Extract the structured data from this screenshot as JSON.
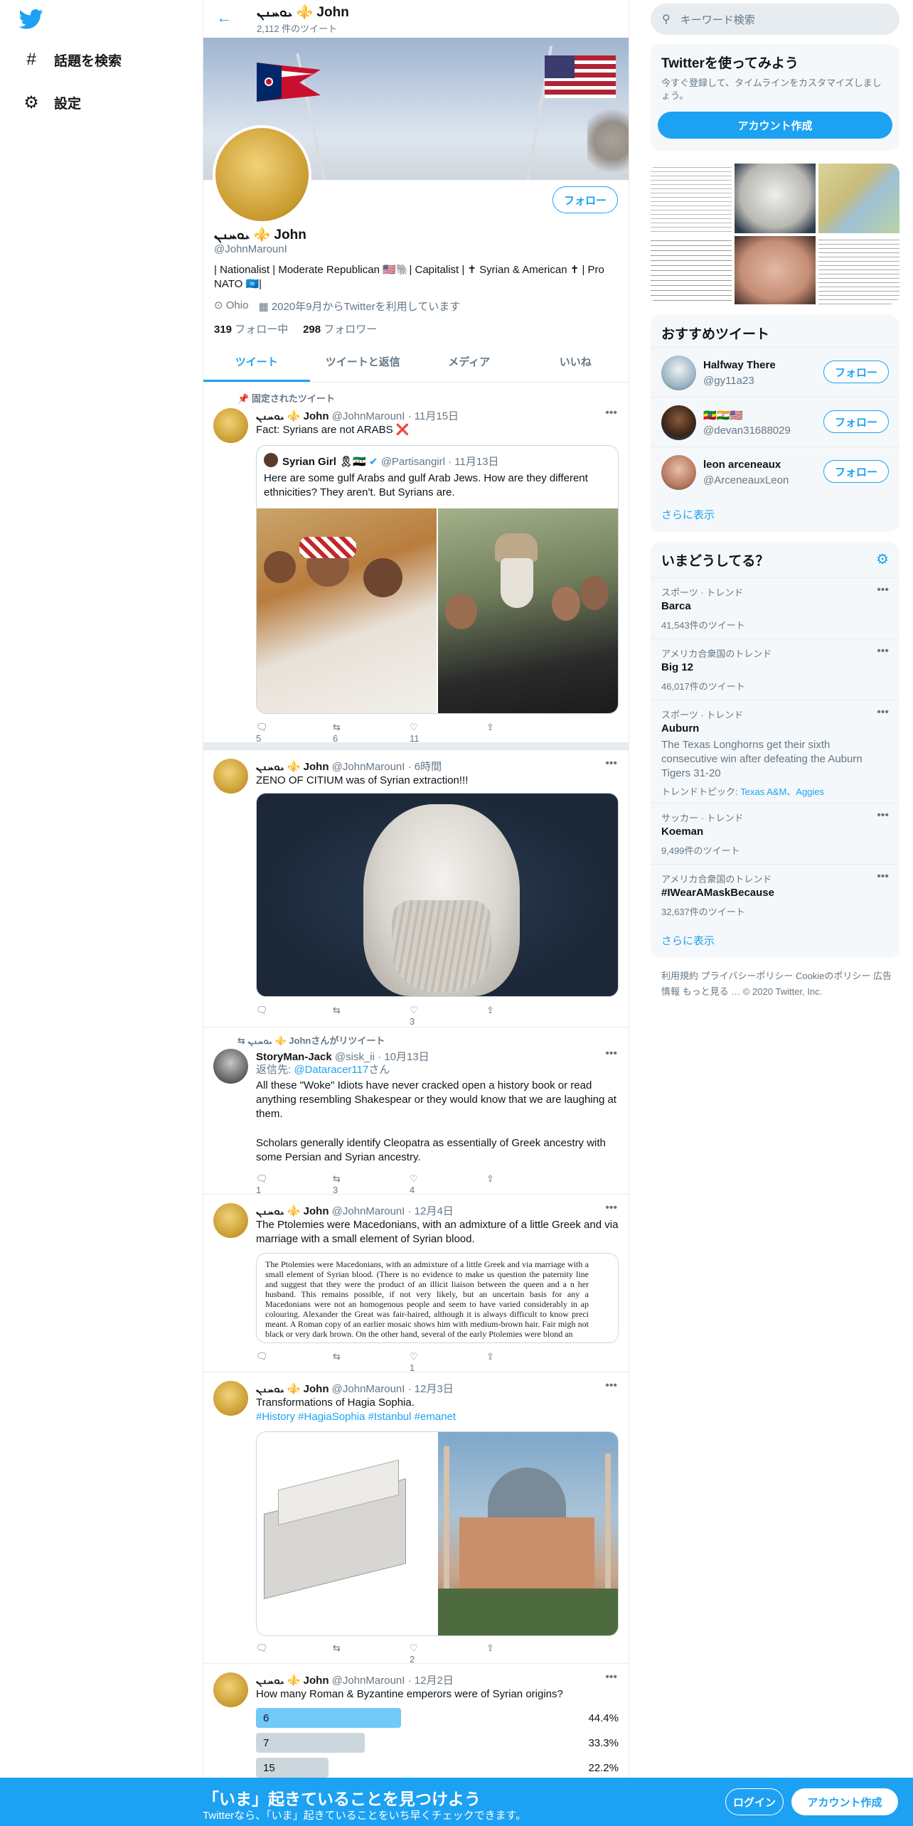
{
  "nav": {
    "explore": "話題を検索",
    "settings": "設定"
  },
  "profile": {
    "name": "ܝܘܚܢܢ ⚜️ John",
    "tweet_count": "2,112 件のツイート",
    "handle": "@JohnMarounI",
    "bio": "| Nationalist | Moderate Republican 🇺🇸🐘| Capitalist | ✝ Syrian & American ✝ | Pro NATO 🇺🇳|",
    "location": "Ohio",
    "joined": "2020年9月からTwitterを利用しています",
    "following_count": "319",
    "following_label": "フォロー中",
    "followers_count": "298",
    "followers_label": "フォロワー",
    "follow_button": "フォロー"
  },
  "tabs": [
    "ツイート",
    "ツイートと返信",
    "メディア",
    "いいね"
  ],
  "tweets": [
    {
      "pinned_label": "固定されたツイート",
      "name": "ܝܘܚܢܢ ⚜️ John",
      "handle": "@JohnMarounI",
      "time": "11月15日",
      "text": "Fact: Syrians are not ARABS ❌",
      "quote_name": "Syrian Girl 🎗🇸🇾",
      "quote_handle": "@Partisangirl",
      "quote_time": "11月13日",
      "quote_text": "Here are some gulf Arabs and gulf Arab Jews. How are they different ethnicities? They aren't. But Syrians are.",
      "replies": "5",
      "retweets": "6",
      "likes": "11"
    },
    {
      "name": "ܝܘܚܢܢ ⚜️ John",
      "handle": "@JohnMarounI",
      "time": "6時間",
      "text": "ZENO OF CITIUM was of Syrian extraction!!!",
      "replies": "",
      "retweets": "",
      "likes": "3"
    },
    {
      "social": "ܝܘܚܢܢ ⚜️ Johnさんがリツイート",
      "name": "StoryMan-Jack",
      "handle": "@sisk_ii",
      "time": "10月13日",
      "reply_prefix": "返信先:",
      "reply_to": "@Dataracer117",
      "reply_suffix": "さん",
      "text1": "All these \"Woke\" Idiots have never cracked open a history book or read anything resembling Shakespear or they would know that we are laughing at them.",
      "text2": "Scholars generally identify Cleopatra as essentially of Greek ancestry with some Persian and Syrian ancestry.",
      "replies": "1",
      "retweets": "3",
      "likes": "4"
    },
    {
      "name": "ܝܘܚܢܢ ⚜️ John",
      "handle": "@JohnMarounI",
      "time": "12月4日",
      "text": "The Ptolemies were Macedonians, with an admixture of a little Greek and via marriage with a small element of Syrian blood.",
      "doc_text": "The Ptolemies were Macedonians, with an admixture of a little Greek and via marriage with a small element of Syrian blood. (There is no evidence to make us question the paternity line and suggest that they were the product of an illicit liaison between the queen and a n her husband. This remains possible, if not very likely, but an uncertain basis for any a Macedonians were not an homogenous people and seem to have varied considerably in ap colouring. Alexander the Great was fair-haired, although it is always difficult to know preci meant. A Roman copy of an earlier mosaic shows him with medium-brown hair. Fair migh not black or very dark brown. On the other hand, several of the early Ptolemies were blond an",
      "replies": "",
      "retweets": "",
      "likes": "1"
    },
    {
      "name": "ܝܘܚܢܢ ⚜️ John",
      "handle": "@JohnMarounI",
      "time": "12月3日",
      "text": "Transformations of Hagia Sophia.",
      "hashtags": "#History #HagiaSophia #Istanbul #emanet",
      "replies": "",
      "retweets": "",
      "likes": "2"
    },
    {
      "name": "ܝܘܚܢܢ ⚜️ John",
      "handle": "@JohnMarounI",
      "time": "12月2日",
      "text": "How many Roman & Byzantine emperors were of Syrian origins?",
      "poll": [
        {
          "label": "6",
          "pct": "44.4%",
          "frac": 0.444
        },
        {
          "label": "7",
          "pct": "33.3%",
          "frac": 0.333
        },
        {
          "label": "15",
          "pct": "22.2%",
          "frac": 0.222
        }
      ]
    }
  ],
  "right": {
    "search_placeholder": "キーワード検索",
    "join_title": "Twitterを使ってみよう",
    "join_sub": "今すぐ登録して、タイムラインをカスタマイズしましょう。",
    "join_button": "アカウント作成",
    "wtf_title": "おすすめツイート",
    "who": [
      {
        "name": "Halfway There",
        "handle": "@gy11a23",
        "button": "フォロー"
      },
      {
        "name": "🇪🇹🇮🇳🇺🇸",
        "handle": "@devan31688029",
        "button": "フォロー"
      },
      {
        "name": "leon arceneaux",
        "handle": "@ArceneauxLeon",
        "button": "フォロー"
      }
    ],
    "show_more": "さらに表示",
    "trends_title": "いまどうしてる？",
    "trends": [
      {
        "cat": "スポーツ · トレンド",
        "name": "Barca",
        "count": "41,543件のツイート"
      },
      {
        "cat": "アメリカ合衆国のトレンド",
        "name": "Big 12",
        "count": "46,017件のツイート"
      },
      {
        "cat": "スポーツ · トレンド",
        "name": "Auburn",
        "desc": "The Texas Longhorns get their sixth consecutive win after defeating the Auburn Tigers 31-20",
        "topic_prefix": "トレンドトピック:",
        "topics": "Texas A&M、Aggies"
      },
      {
        "cat": "サッカー · トレンド",
        "name": "Koeman",
        "count": "9,499件のツイート"
      },
      {
        "cat": "アメリカ合衆国のトレンド",
        "name": "#IWearAMaskBecause",
        "count": "32,637件のツイート"
      }
    ],
    "trends_more": "さらに表示",
    "footer": "利用規約  プライバシーポリシー  Cookieのポリシー  広告情報  もっと見る …  © 2020 Twitter, Inc."
  },
  "bottom": {
    "title": "「いま」起きていることを見つけよう",
    "sub": "Twitterなら、「いま」起きていることをいち早くチェックできます。",
    "login": "ログイン",
    "signup": "アカウント作成"
  },
  "colors": {
    "accent": "#1da1f2",
    "poll_lead": "#71c9f8",
    "poll_other": "#ccd6dd"
  }
}
